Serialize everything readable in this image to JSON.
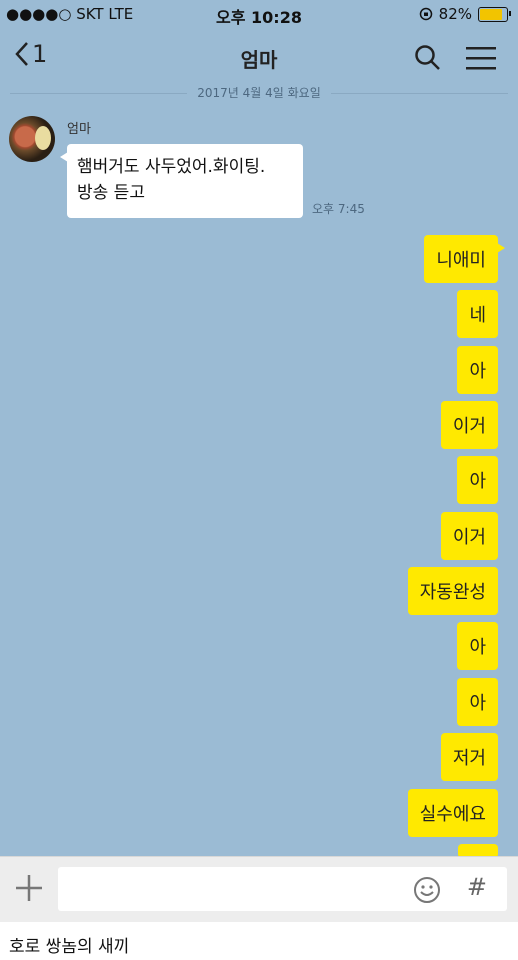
{
  "status_bar": {
    "carrier": "●●●●○ SKT  LTE",
    "time": "오후 10:28",
    "battery": "82%"
  },
  "header": {
    "back_count": "1",
    "title": "엄마"
  },
  "date_divider": "2017년 4월 4일 화요일",
  "incoming": {
    "sender": "엄마",
    "line1": "햄버거도 사두었어.화이팅.",
    "line2": "방송 듣고",
    "time": "오후 7:45"
  },
  "outgoing": [
    "니애미",
    "네",
    "아",
    "이거",
    "아",
    "이거",
    "자동완성",
    "아",
    "아",
    "저거",
    "실수에요"
  ],
  "caption": "호로 쌍놈의 새끼"
}
